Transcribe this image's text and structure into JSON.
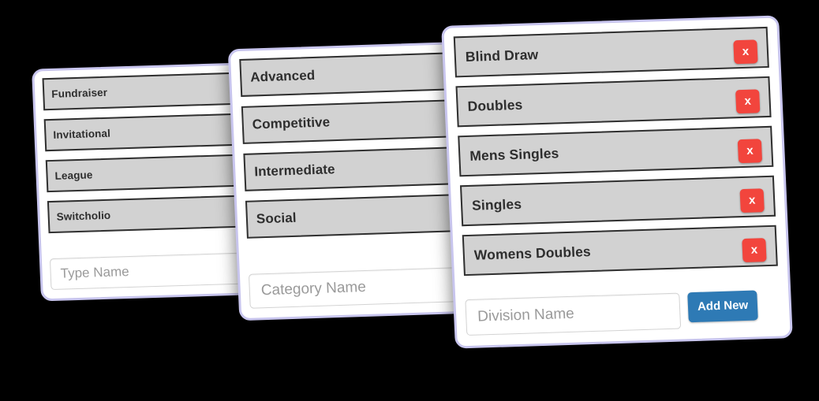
{
  "background_color": "#000000",
  "theme": {
    "card_border_color": "#c8c5ee",
    "card_background": "#ffffff",
    "list_item_background": "#d2d2d2",
    "list_item_border_color": "#2f2f2f",
    "list_item_text_color": "#2e2e2e",
    "delete_button_color": "#f2453d",
    "add_button_color": "#2e7ab5",
    "placeholder_color": "#9a9a9a"
  },
  "cards": {
    "types": {
      "name": "types-card",
      "items": [
        {
          "label": "Fundraiser"
        },
        {
          "label": "Invitational"
        },
        {
          "label": "League"
        },
        {
          "label": "Switcholio"
        }
      ],
      "input": {
        "value": "",
        "placeholder": "Type Name"
      }
    },
    "categories": {
      "name": "categories-card",
      "items": [
        {
          "label": "Advanced"
        },
        {
          "label": "Competitive"
        },
        {
          "label": "Intermediate"
        },
        {
          "label": "Social"
        }
      ],
      "input": {
        "value": "",
        "placeholder": "Category Name"
      }
    },
    "divisions": {
      "name": "divisions-card",
      "items": [
        {
          "label": "Blind Draw",
          "delete_label": "x"
        },
        {
          "label": "Doubles",
          "delete_label": "x"
        },
        {
          "label": "Mens Singles",
          "delete_label": "x"
        },
        {
          "label": "Singles",
          "delete_label": "x"
        },
        {
          "label": "Womens Doubles",
          "delete_label": "x"
        }
      ],
      "input": {
        "value": "",
        "placeholder": "Division Name"
      },
      "add_button_label": "Add New"
    }
  }
}
